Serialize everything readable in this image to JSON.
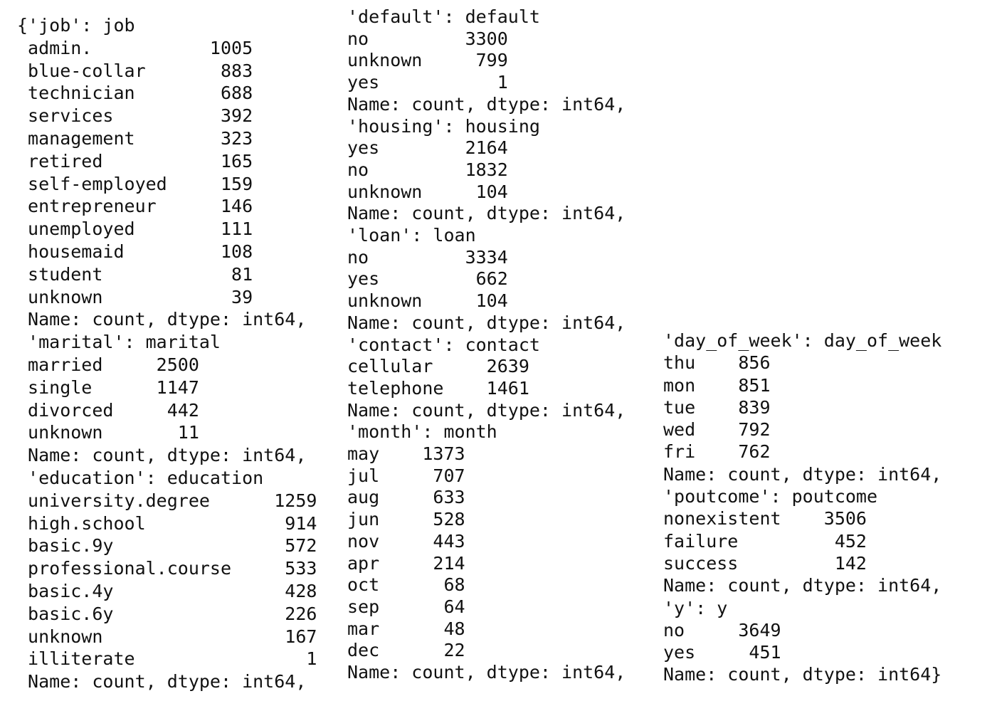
{
  "output": {
    "col1": [
      "{'job': job",
      " admin.           1005",
      " blue-collar       883",
      " technician        688",
      " services          392",
      " management        323",
      " retired           165",
      " self-employed     159",
      " entrepreneur      146",
      " unemployed        111",
      " housemaid         108",
      " student            81",
      " unknown            39",
      " Name: count, dtype: int64,",
      " 'marital': marital",
      " married     2500",
      " single      1147",
      " divorced     442",
      " unknown       11",
      " Name: count, dtype: int64,",
      " 'education': education",
      " university.degree      1259",
      " high.school             914",
      " basic.9y                572",
      " professional.course     533",
      " basic.4y                428",
      " basic.6y                226",
      " unknown                 167",
      " illiterate                1",
      " Name: count, dtype: int64,"
    ],
    "col2": [
      "'default': default",
      "no         3300",
      "unknown     799",
      "yes           1",
      "Name: count, dtype: int64,",
      "'housing': housing",
      "yes        2164",
      "no         1832",
      "unknown     104",
      "Name: count, dtype: int64,",
      "'loan': loan",
      "no         3334",
      "yes         662",
      "unknown     104",
      "Name: count, dtype: int64,",
      "'contact': contact",
      "cellular     2639",
      "telephone    1461",
      "Name: count, dtype: int64,",
      "'month': month",
      "may    1373",
      "jul     707",
      "aug     633",
      "jun     528",
      "nov     443",
      "apr     214",
      "oct      68",
      "sep      64",
      "mar      48",
      "dec      22",
      "Name: count, dtype: int64,"
    ],
    "col3": [
      "'day_of_week': day_of_week",
      "thu    856",
      "mon    851",
      "tue    839",
      "wed    792",
      "fri    762",
      "Name: count, dtype: int64,",
      "'poutcome': poutcome",
      "nonexistent    3506",
      "failure         452",
      "success         142",
      "Name: count, dtype: int64,",
      "'y': y",
      "no     3649",
      "yes     451",
      "Name: count, dtype: int64}"
    ]
  }
}
